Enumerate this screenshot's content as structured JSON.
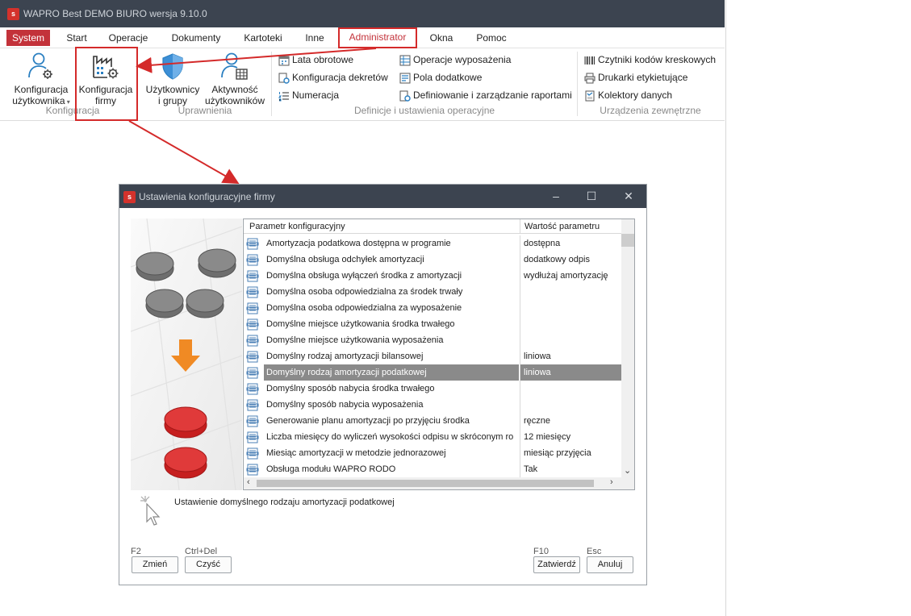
{
  "app": {
    "title": "WAPRO Best DEMO BIURO wersja 9.10.0",
    "logo_letter": "s"
  },
  "menu": {
    "items": [
      "System",
      "Start",
      "Operacje",
      "Dokumenty",
      "Kartoteki",
      "Inne",
      "Administrator",
      "Okna",
      "Pomoc"
    ],
    "active": "System",
    "highlighted": "Administrator"
  },
  "ribbon": {
    "konfiguracja_uzytkownika": "Konfiguracja użytkownika",
    "konfiguracja_uzytkownika_l1": "Konfiguracja",
    "konfiguracja_uzytkownika_l2": "użytkownika",
    "konfiguracja_firmy_l1": "Konfiguracja",
    "konfiguracja_firmy_l2": "firmy",
    "uzytkownicy_l1": "Użytkownicy",
    "uzytkownicy_l2": "i grupy",
    "aktywnosc_l1": "Aktywność",
    "aktywnosc_l2": "użytkowników",
    "group_konfiguracja": "Konfiguracja",
    "group_uprawnienia": "Uprawnienia",
    "lata_obrotowe": "Lata obrotowe",
    "konfiguracja_dekretow": "Konfiguracja dekretów",
    "numeracja": "Numeracja",
    "operacje_wyposazenia": "Operacje wyposażenia",
    "pola_dodatkowe": "Pola dodatkowe",
    "definiowanie_raportami": "Definiowanie i zarządzanie raportami",
    "group_definicje": "Definicje i ustawienia operacyjne",
    "czytniki": "Czytniki kodów kreskowych",
    "drukarki": "Drukarki etykietujące",
    "kolektory": "Kolektory danych",
    "group_urzadzenia": "Urządzenia zewnętrzne"
  },
  "dialog": {
    "title": "Ustawienia konfiguracyjne firmy",
    "col_param": "Parametr konfiguracyjny",
    "col_value": "Wartość parametru",
    "rows": [
      {
        "name": "Amortyzacja podatkowa dostępna w programie",
        "value": "dostępna"
      },
      {
        "name": "Domyślna obsługa odchyłek amortyzacji",
        "value": "dodatkowy odpis"
      },
      {
        "name": "Domyślna obsługa wyłączeń środka z amortyzacji",
        "value": "wydłużaj amortyzację"
      },
      {
        "name": "Domyślna osoba odpowiedzialna za środek trwały",
        "value": ""
      },
      {
        "name": "Domyślna osoba odpowiedzialna za wyposażenie",
        "value": ""
      },
      {
        "name": "Domyślne miejsce użytkowania środka trwałego",
        "value": ""
      },
      {
        "name": "Domyślne miejsce użytkowania wyposażenia",
        "value": ""
      },
      {
        "name": "Domyślny rodzaj amortyzacji bilansowej",
        "value": "liniowa"
      },
      {
        "name": "Domyślny rodzaj amortyzacji podatkowej",
        "value": "liniowa"
      },
      {
        "name": "Domyślny sposób nabycia środka trwałego",
        "value": ""
      },
      {
        "name": "Domyślny sposób nabycia wyposażenia",
        "value": ""
      },
      {
        "name": "Generowanie planu amortyzacji po przyjęciu środka",
        "value": "ręczne"
      },
      {
        "name": "Liczba miesięcy do wyliczeń wysokości odpisu w skróconym ro",
        "value": "12 miesięcy"
      },
      {
        "name": "Miesiąc amortyzacji w metodzie jednorazowej",
        "value": "miesiąc przyjęcia"
      },
      {
        "name": "Obsługa modułu WAPRO RODO",
        "value": "Tak"
      }
    ],
    "selected_index": 8,
    "description": "Ustawienie domyślnego rodzaju amortyzacji podatkowej",
    "key_f2": "F2",
    "btn_zmien": "Zmień",
    "key_ctrl_del": "Ctrl+Del",
    "btn_czysc": "Czyść",
    "key_f10": "F10",
    "btn_zatwierdz": "Zatwierdź",
    "key_esc": "Esc",
    "btn_anuluj": "Anuluj"
  },
  "colors": {
    "titlebar": "#3c4450",
    "accent_red": "#c3323a",
    "annotation_red": "#d42a2a",
    "selection_gray": "#8a8a8a"
  }
}
